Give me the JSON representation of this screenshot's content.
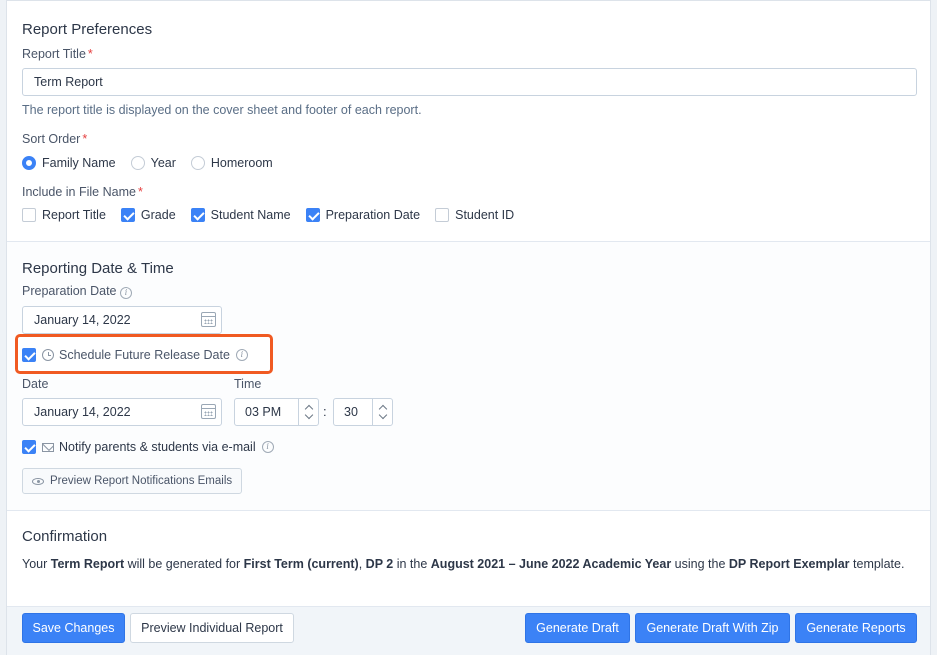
{
  "report_prefs": {
    "heading": "Report Preferences",
    "title_label": "Report Title",
    "required_mark": "*",
    "title_value": "Term Report",
    "title_hint": "The report title is displayed on the cover sheet and footer of each report.",
    "sort_label": "Sort Order",
    "sort_options": [
      {
        "label": "Family Name",
        "selected": true
      },
      {
        "label": "Year",
        "selected": false
      },
      {
        "label": "Homeroom",
        "selected": false
      }
    ],
    "filename_label": "Include in File Name",
    "filename_options": [
      {
        "label": "Report Title",
        "checked": false
      },
      {
        "label": "Grade",
        "checked": true
      },
      {
        "label": "Student Name",
        "checked": true
      },
      {
        "label": "Preparation Date",
        "checked": true
      },
      {
        "label": "Student ID",
        "checked": false
      }
    ]
  },
  "reporting": {
    "heading": "Reporting Date & Time",
    "prep_date_label": "Preparation Date",
    "prep_date_value": "January 14, 2022",
    "schedule_label": "Schedule Future Release Date",
    "schedule_checked": true,
    "date_label": "Date",
    "date_value": "January 14, 2022",
    "time_label": "Time",
    "hour_value": "03 PM",
    "time_separator": ":",
    "minute_value": "30",
    "notify_label": "Notify parents & students via e-mail",
    "notify_checked": true,
    "preview_emails_label": "Preview Report Notifications Emails"
  },
  "confirmation": {
    "heading": "Confirmation",
    "t1": "Your ",
    "b1": "Term Report",
    "t2": " will be generated for ",
    "b2": "First Term (current)",
    "t3": ", ",
    "b3": "DP 2",
    "t4": " in the ",
    "b4": "August 2021 – June 2022 Academic Year",
    "t5": " using the ",
    "b5": "DP Report Exemplar",
    "t6": " template."
  },
  "footer": {
    "save_label": "Save Changes",
    "preview_label": "Preview Individual Report",
    "draft_label": "Generate Draft",
    "draft_zip_label": "Generate Draft With Zip",
    "generate_label": "Generate Reports"
  },
  "colors": {
    "accent": "#3b82f6",
    "highlight": "#f05a22",
    "required": "#e53e3e"
  }
}
